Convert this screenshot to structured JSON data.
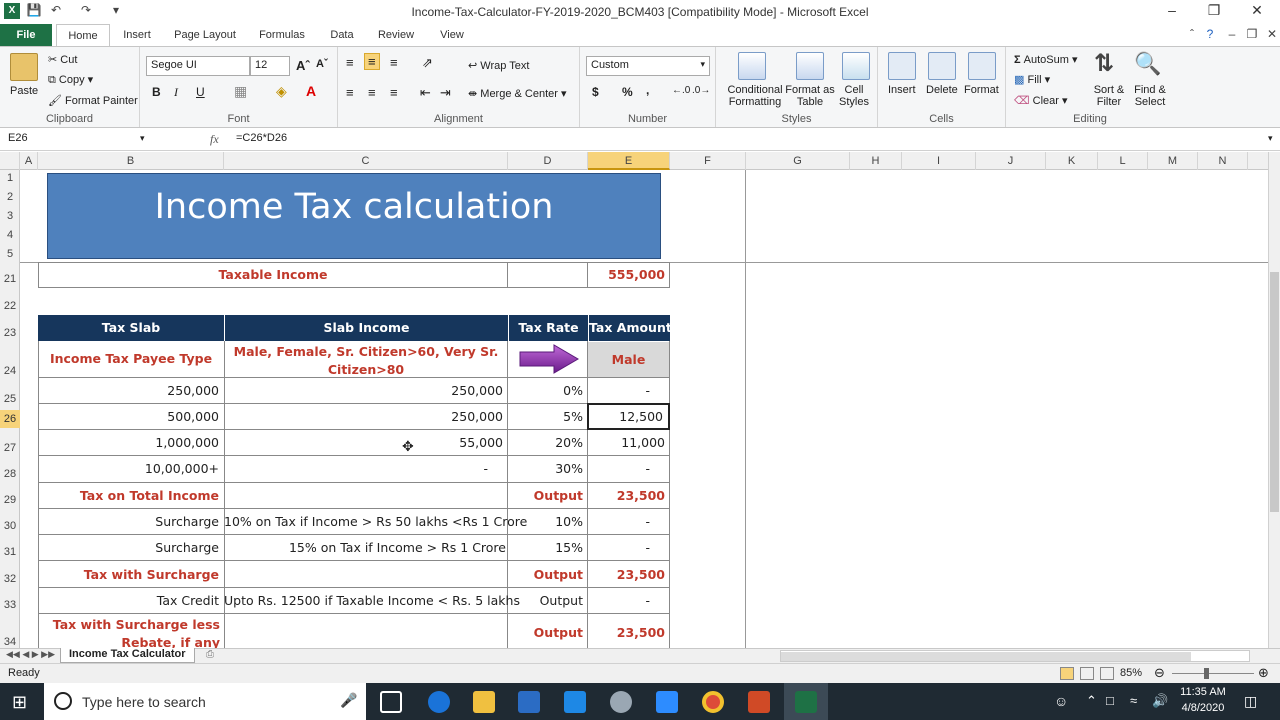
{
  "window": {
    "title": "Income-Tax-Calculator-FY-2019-2020_BCM403  [Compatibility Mode]  -  Microsoft Excel"
  },
  "tabs": [
    "File",
    "Home",
    "Insert",
    "Page Layout",
    "Formulas",
    "Data",
    "Review",
    "View"
  ],
  "ribbon": {
    "clipboard": {
      "paste": "Paste",
      "cut": "Cut",
      "copy": "Copy",
      "format_painter": "Format Painter",
      "label": "Clipboard"
    },
    "font": {
      "name": "Segoe UI",
      "size": "12",
      "label": "Font",
      "bold": "B",
      "italic": "I",
      "underline": "U"
    },
    "alignment": {
      "wrap": "Wrap Text",
      "merge": "Merge & Center",
      "label": "Alignment"
    },
    "number": {
      "format": "Custom",
      "label": "Number",
      "currency": "$",
      "percent": "%",
      "comma": ","
    },
    "styles": {
      "cond": "Conditional Formatting",
      "table": "Format as Table",
      "cell": "Cell Styles",
      "label": "Styles"
    },
    "cells": {
      "insert": "Insert",
      "delete": "Delete",
      "format": "Format",
      "label": "Cells"
    },
    "editing": {
      "autosum": "AutoSum",
      "fill": "Fill",
      "clear": "Clear",
      "sort": "Sort & Filter",
      "find": "Find & Select",
      "label": "Editing"
    }
  },
  "formula_bar": {
    "name_box": "E26",
    "fx": "fx",
    "formula": "=C26*D26"
  },
  "columns": [
    "A",
    "B",
    "C",
    "D",
    "E",
    "F",
    "G",
    "H",
    "I",
    "J",
    "K",
    "L",
    "M",
    "N"
  ],
  "rows": [
    "1",
    "2",
    "3",
    "4",
    "5",
    "21",
    "22",
    "23",
    "24",
    "25",
    "26",
    "27",
    "28",
    "29",
    "30",
    "31",
    "32",
    "33",
    "34"
  ],
  "sheet": {
    "banner": "Income Tax calculation",
    "taxable_label": "Taxable Income",
    "taxable_value": "555,000",
    "headers": [
      "Tax Slab",
      "Slab Income",
      "Tax Rate",
      "Tax Amount"
    ],
    "payee_type_label": "Income Tax Payee Type",
    "payee_options": "Male, Female, Sr. Citizen>60, Very Sr. Citizen>80",
    "payee_value": "Male",
    "slabs": [
      {
        "slab": "250,000",
        "income": "250,000",
        "rate": "0%",
        "amount": "-"
      },
      {
        "slab": "500,000",
        "income": "250,000",
        "rate": "5%",
        "amount": "12,500"
      },
      {
        "slab": "1,000,000",
        "income": "55,000",
        "rate": "20%",
        "amount": "11,000"
      },
      {
        "slab": "10,00,000+",
        "income": "-",
        "rate": "30%",
        "amount": "-"
      }
    ],
    "total_tax": {
      "label": "Tax on Total Income",
      "rate": "Output",
      "amount": "23,500"
    },
    "surcharge1": {
      "label": "Surcharge",
      "desc": "10% on Tax if Income > Rs 50 lakhs <Rs 1 Crore",
      "rate": "10%",
      "amount": "-"
    },
    "surcharge2": {
      "label": "Surcharge",
      "desc": "15% on Tax if Income > Rs 1 Crore",
      "rate": "15%",
      "amount": "-"
    },
    "with_surcharge": {
      "label": "Tax with Surcharge",
      "rate": "Output",
      "amount": "23,500"
    },
    "tax_credit": {
      "label": "Tax Credit",
      "desc": "Upto Rs. 12500 if Taxable Income < Rs. 5 lakhs",
      "rate": "Output",
      "amount": "-"
    },
    "less_rebate": {
      "label": "Tax with Surcharge less Rebate, if any",
      "rate": "Output",
      "amount": "23,500"
    }
  },
  "sheet_tab": "Income Tax Calculator",
  "status": {
    "ready": "Ready",
    "zoom": "85%"
  },
  "taskbar": {
    "search": "Type here to search",
    "time": "11:35 AM",
    "date": "4/8/2020"
  },
  "colors": {
    "excel_green": "#1e7145",
    "header_navy": "#16365c",
    "banner_blue": "#4f81bd",
    "red_text": "#c0392b"
  }
}
